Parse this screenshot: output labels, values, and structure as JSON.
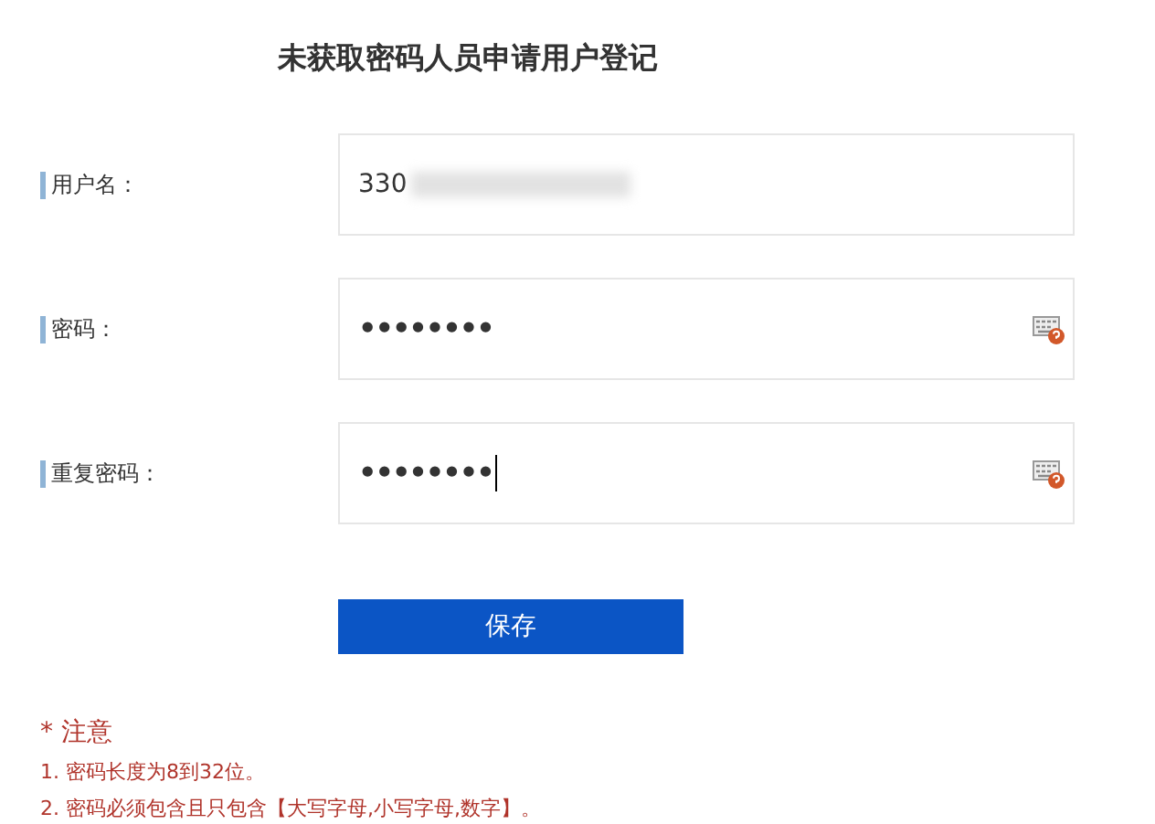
{
  "title": "未获取密码人员申请用户登记",
  "fields": [
    {
      "label": "用户名：",
      "value": "330",
      "redacted": true,
      "keyboard_icon": false,
      "cursor": false
    },
    {
      "label": "密码：",
      "value": "••••••••",
      "redacted": false,
      "keyboard_icon": true,
      "cursor": false
    },
    {
      "label": "重复密码：",
      "value": "••••••••",
      "redacted": false,
      "keyboard_icon": true,
      "cursor": true
    }
  ],
  "save_button": "保存",
  "notice": {
    "heading": "* 注意",
    "lines": [
      "1. 密码长度为8到32位。",
      "2. 密码必须包含且只包含【大写字母,小写字母,数字】。"
    ]
  }
}
